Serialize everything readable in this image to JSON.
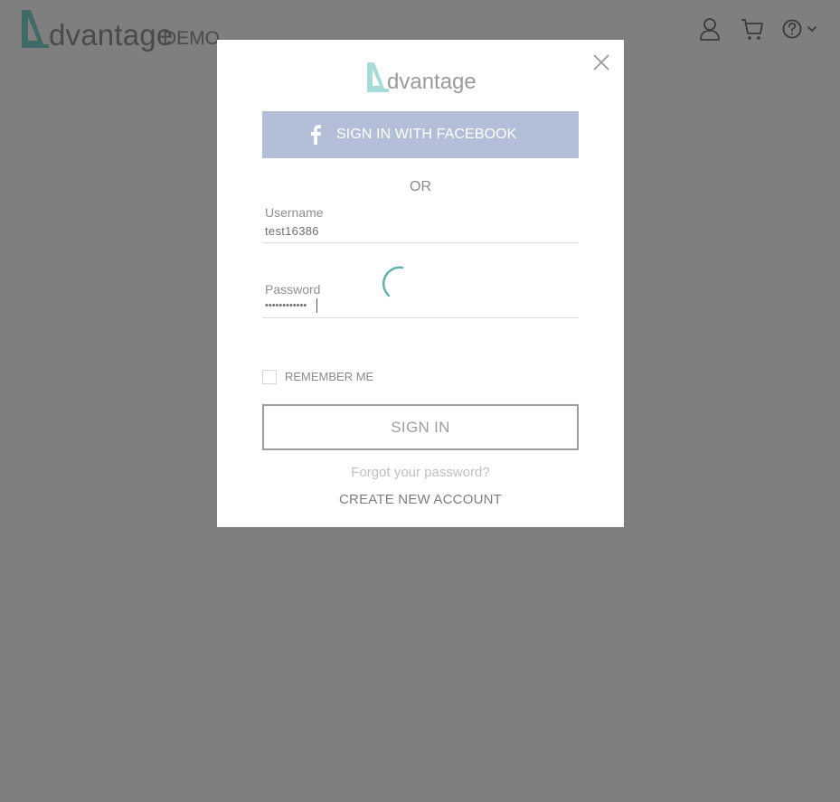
{
  "header": {
    "brand_word": "dvantage",
    "brand_demo": "DEMO",
    "icons": [
      "user-icon",
      "cart-icon",
      "help-icon"
    ]
  },
  "modal": {
    "logo_word": "dvantage",
    "facebook_label": "SIGN IN WITH FACEBOOK",
    "or_label": "OR",
    "username": {
      "label": "Username",
      "value": "test16386"
    },
    "password": {
      "label": "Password",
      "value": "••••••••••••"
    },
    "remember_label": "REMEMBER ME",
    "remember_checked": false,
    "signin_label": "SIGN IN",
    "forgot_label": "Forgot your password?",
    "create_label": "CREATE NEW ACCOUNT",
    "loading": true
  },
  "colors": {
    "backdrop": "#7f7f7f",
    "brand_teal": "#3f7f7a",
    "facebook": "#b3bed9",
    "spinner": "#5fb3aa"
  }
}
